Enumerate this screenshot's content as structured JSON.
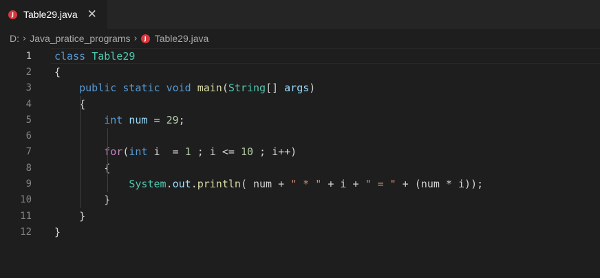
{
  "tab": {
    "label": "Table29.java",
    "close_glyph": "✕",
    "icon_letter": "J",
    "icon_color": "#d9363e"
  },
  "breadcrumb": {
    "drive": "D:",
    "folder": "Java_pratice_programs",
    "file": "Table29.java",
    "separator": "›"
  },
  "editor": {
    "active_line": 1,
    "lines": [
      {
        "n": "1",
        "tokens": [
          [
            "kw",
            "class"
          ],
          [
            "plain",
            " "
          ],
          [
            "ty",
            "Table29"
          ]
        ]
      },
      {
        "n": "2",
        "tokens": [
          [
            "plain",
            "{"
          ]
        ]
      },
      {
        "n": "3",
        "tokens": [
          [
            "plain",
            "    "
          ],
          [
            "kw",
            "public"
          ],
          [
            "plain",
            " "
          ],
          [
            "kw",
            "static"
          ],
          [
            "plain",
            " "
          ],
          [
            "kw",
            "void"
          ],
          [
            "plain",
            " "
          ],
          [
            "fn",
            "main"
          ],
          [
            "plain",
            "("
          ],
          [
            "ty",
            "String"
          ],
          [
            "plain",
            "[] "
          ],
          [
            "var",
            "args"
          ],
          [
            "plain",
            ")"
          ]
        ]
      },
      {
        "n": "4",
        "tokens": [
          [
            "plain",
            "    {"
          ]
        ]
      },
      {
        "n": "5",
        "tokens": [
          [
            "plain",
            "        "
          ],
          [
            "kw",
            "int"
          ],
          [
            "plain",
            " "
          ],
          [
            "var",
            "num"
          ],
          [
            "plain",
            " = "
          ],
          [
            "num",
            "29"
          ],
          [
            "plain",
            ";"
          ]
        ]
      },
      {
        "n": "6",
        "tokens": []
      },
      {
        "n": "7",
        "tokens": [
          [
            "plain",
            "        "
          ],
          [
            "ctl",
            "for"
          ],
          [
            "plain",
            "("
          ],
          [
            "kw",
            "int"
          ],
          [
            "plain",
            " i  = "
          ],
          [
            "num",
            "1"
          ],
          [
            "plain",
            " ; i <= "
          ],
          [
            "num",
            "10"
          ],
          [
            "plain",
            " ; i++)"
          ]
        ]
      },
      {
        "n": "8",
        "tokens": [
          [
            "plain",
            "        {"
          ]
        ]
      },
      {
        "n": "9",
        "tokens": [
          [
            "plain",
            "            "
          ],
          [
            "ty",
            "System"
          ],
          [
            "plain",
            "."
          ],
          [
            "var",
            "out"
          ],
          [
            "plain",
            "."
          ],
          [
            "fn",
            "println"
          ],
          [
            "plain",
            "( num + "
          ],
          [
            "str",
            "\" * \""
          ],
          [
            "plain",
            " + i + "
          ],
          [
            "str",
            "\" = \""
          ],
          [
            "plain",
            " + (num * i));"
          ]
        ]
      },
      {
        "n": "10",
        "tokens": [
          [
            "plain",
            "        }"
          ]
        ]
      },
      {
        "n": "11",
        "tokens": [
          [
            "plain",
            "    }"
          ]
        ]
      },
      {
        "n": "12",
        "tokens": [
          [
            "plain",
            "}"
          ]
        ]
      }
    ]
  },
  "colors": {
    "background": "#1e1e1e",
    "keyword": "#569cd6",
    "type": "#4ec9b0",
    "function": "#dcdcaa",
    "variable": "#9cdcfe",
    "number": "#b5cea8",
    "string": "#ce9178",
    "control": "#c586c0"
  }
}
